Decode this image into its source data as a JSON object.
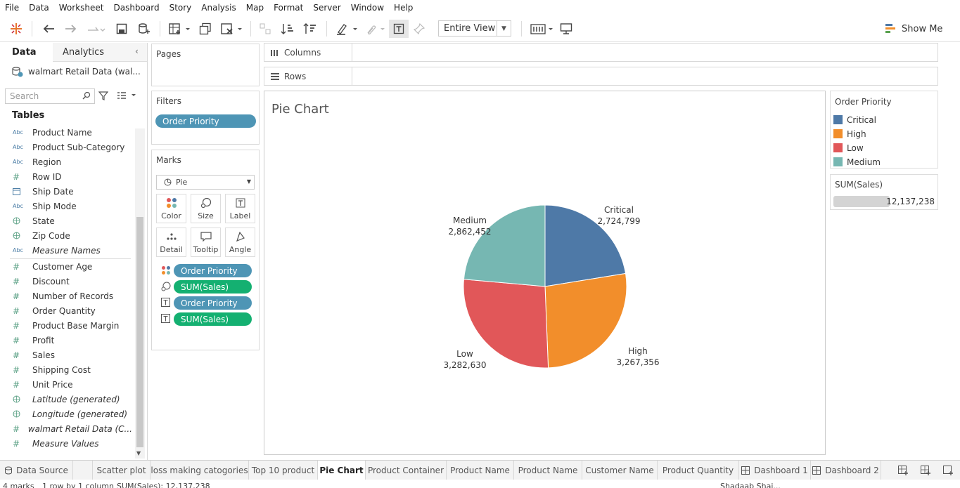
{
  "menu": [
    "File",
    "Data",
    "Worksheet",
    "Dashboard",
    "Story",
    "Analysis",
    "Map",
    "Format",
    "Server",
    "Window",
    "Help"
  ],
  "toolbar": {
    "view_mode": "Entire View",
    "show_me": "Show Me"
  },
  "sidebar": {
    "tab_data": "Data",
    "tab_analytics": "Analytics",
    "datasource": "walmart Retail Data (wal...",
    "search_placeholder": "Search",
    "tables_heading": "Tables",
    "dimensions": [
      {
        "type": "Abc",
        "name": "Product Name"
      },
      {
        "type": "Abc",
        "name": "Product Sub-Category"
      },
      {
        "type": "Abc",
        "name": "Region"
      },
      {
        "type": "#",
        "name": "Row ID"
      },
      {
        "type": "date",
        "name": "Ship Date"
      },
      {
        "type": "Abc",
        "name": "Ship Mode"
      },
      {
        "type": "geo",
        "name": "State"
      },
      {
        "type": "geo",
        "name": "Zip Code"
      },
      {
        "type": "Abc",
        "name": "Measure Names"
      }
    ],
    "measures": [
      {
        "type": "#",
        "name": "Customer Age"
      },
      {
        "type": "#",
        "name": "Discount"
      },
      {
        "type": "#",
        "name": "Number of Records"
      },
      {
        "type": "#",
        "name": "Order Quantity"
      },
      {
        "type": "#",
        "name": "Product Base Margin"
      },
      {
        "type": "#",
        "name": "Profit"
      },
      {
        "type": "#",
        "name": "Sales"
      },
      {
        "type": "#",
        "name": "Shipping Cost"
      },
      {
        "type": "#",
        "name": "Unit Price"
      },
      {
        "type": "geo",
        "name": "Latitude (generated)"
      },
      {
        "type": "geo",
        "name": "Longitude (generated)"
      },
      {
        "type": "#",
        "name": "walmart Retail Data (C..."
      },
      {
        "type": "#",
        "name": "Measure Values"
      }
    ]
  },
  "pages": {
    "title": "Pages"
  },
  "filters": {
    "title": "Filters",
    "pill": "Order Priority"
  },
  "marks": {
    "title": "Marks",
    "type": "Pie",
    "buttons": [
      "Color",
      "Size",
      "Label",
      "Detail",
      "Tooltip",
      "Angle"
    ],
    "pills": [
      {
        "icon": "color",
        "label": "Order Priority",
        "kind": "blue"
      },
      {
        "icon": "size",
        "label": "SUM(Sales)",
        "kind": "green"
      },
      {
        "icon": "label",
        "label": "Order Priority",
        "kind": "blue"
      },
      {
        "icon": "label",
        "label": "SUM(Sales)",
        "kind": "green"
      }
    ]
  },
  "shelves": {
    "columns": "Columns",
    "rows": "Rows"
  },
  "viz": {
    "title": "Pie Chart"
  },
  "legend": {
    "title": "Order Priority",
    "items": [
      {
        "label": "Critical",
        "color": "#4e79a7"
      },
      {
        "label": "High",
        "color": "#f28e2b"
      },
      {
        "label": "Low",
        "color": "#e15759"
      },
      {
        "label": "Medium",
        "color": "#76b7b2"
      }
    ]
  },
  "size_legend": {
    "title": "SUM(Sales)",
    "value": "12,137,238"
  },
  "chart_data": {
    "type": "pie",
    "title": "Pie Chart",
    "categories": [
      "Critical",
      "High",
      "Low",
      "Medium"
    ],
    "values": [
      2724799,
      3267356,
      3282630,
      2862452
    ],
    "value_labels": [
      "2,724,799",
      "3,267,356",
      "3,282,630",
      "2,862,452"
    ],
    "colors": [
      "#4e79a7",
      "#f28e2b",
      "#e15759",
      "#76b7b2"
    ],
    "total": "12,137,238",
    "legend_position": "right"
  },
  "sheet_tabs": [
    "Scatter plot",
    "loss making catogories",
    "Top 10 product",
    "Pie Chart",
    "Product Container",
    "Product Name",
    "Product Name",
    "Customer Name",
    "Product Quantity",
    "Dashboard 1",
    "Dashboard 2"
  ],
  "data_source_tab": "Data Source",
  "active_tab": "Pie Chart",
  "status": {
    "marks": "4 marks",
    "rows": "1 row by 1 column",
    "sum": "SUM(Sales): 12,137,238",
    "user": "Shadaab Shai..."
  }
}
